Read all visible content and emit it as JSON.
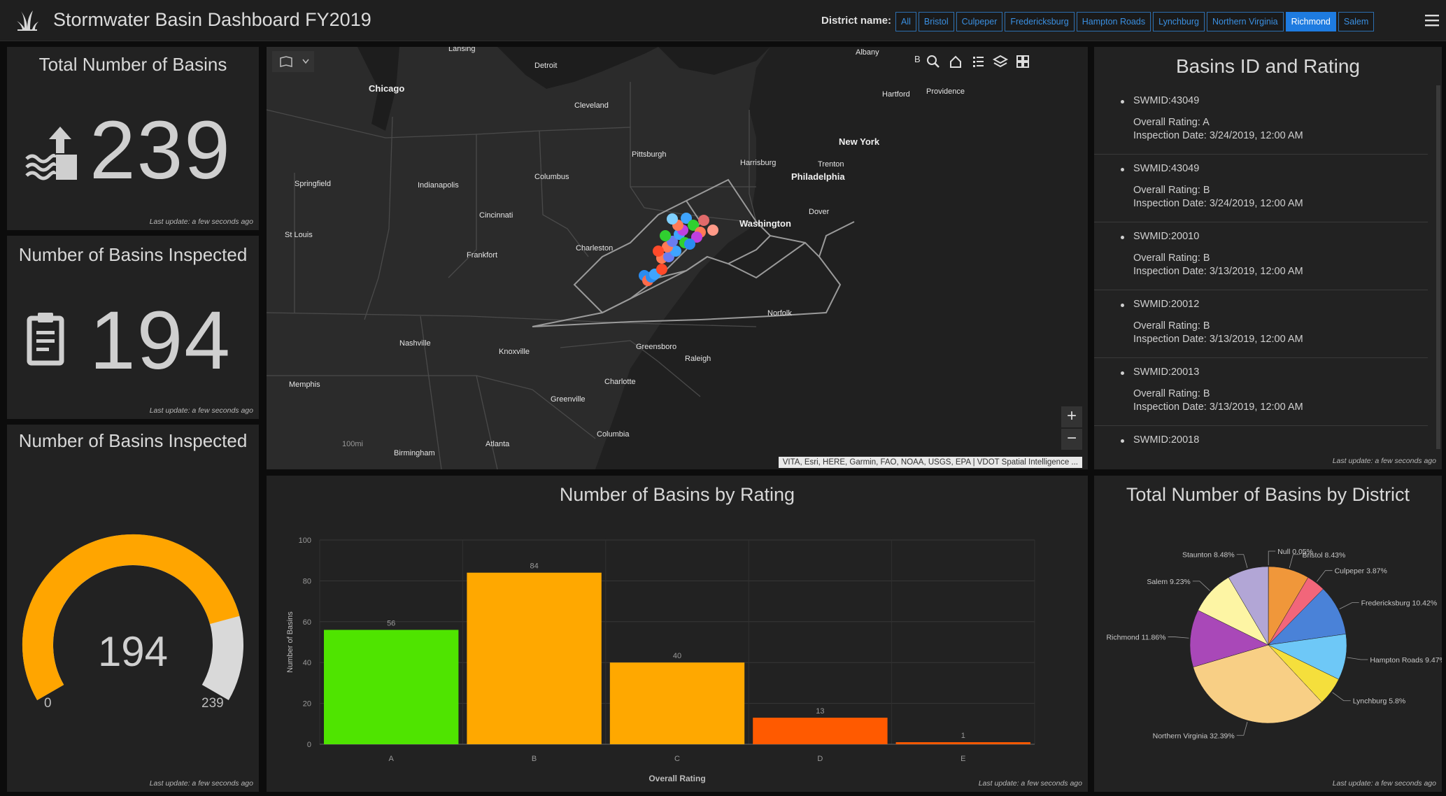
{
  "header": {
    "title": "Stormwater Basin Dashboard FY2019",
    "filter_label": "District name:",
    "districts": [
      "All",
      "Bristol",
      "Culpeper",
      "Fredericksburg",
      "Hampton Roads",
      "Lynchburg",
      "Northern Virginia",
      "Richmond",
      "Salem"
    ],
    "selected_district": "Richmond",
    "accent_color": "#1e7be0"
  },
  "indicator_total": {
    "title": "Total Number of Basins",
    "value": "239",
    "icon": "water-level-icon",
    "updated": "Last update: a few seconds ago"
  },
  "indicator_inspected": {
    "title": "Number of Basins Inspected",
    "value": "194",
    "icon": "clipboard-icon",
    "updated": "Last update: a few seconds ago"
  },
  "gauge": {
    "title": "Number of Basins Inspected",
    "value": 194,
    "value_label": "194",
    "min": 0,
    "max": 239,
    "min_label": "0",
    "max_label": "239",
    "fill_color": "#ffa500",
    "track_color": "#d9d9d9",
    "updated": "Last update: a few seconds ago"
  },
  "map": {
    "attribution": "VITA, Esri, HERE, Garmin, FAO, NOAA, USGS, EPA | VDOT Spatial Intelligence ...",
    "scale_label": "100mi",
    "partial_label": "B",
    "cities": {
      "lansing": "Lansing",
      "detroit": "Detroit",
      "albany": "Albany",
      "chicago": "Chicago",
      "cleveland": "Cleveland",
      "hartford": "Hartford",
      "providence": "Providence",
      "pittsburgh": "Pittsburgh",
      "new_york": "New York",
      "harrisburg": "Harrisburg",
      "trenton": "Trenton",
      "philadelphia": "Philadelphia",
      "springfield": "Springfield",
      "indianapolis": "Indianapolis",
      "columbus": "Columbus",
      "cincinnati": "Cincinnati",
      "washington": "Washington",
      "dover": "Dover",
      "st_louis": "St Louis",
      "frankfort": "Frankfort",
      "charleston": "Charleston",
      "nashville": "Nashville",
      "knoxville": "Knoxville",
      "greensboro": "Greensboro",
      "raleigh": "Raleigh",
      "norfolk": "Norfolk",
      "memphis": "Memphis",
      "charlotte": "Charlotte",
      "greenville": "Greenville",
      "columbia": "Columbia",
      "atlanta": "Atlanta",
      "birmingham": "Birmingham"
    }
  },
  "basin_list": {
    "title": "Basins ID and Rating",
    "items": [
      {
        "id": "SWMID:43049",
        "rating": "Overall Rating: A",
        "date": "Inspection Date: 3/24/2019, 12:00 AM"
      },
      {
        "id": "SWMID:43049",
        "rating": "Overall Rating: B",
        "date": "Inspection Date: 3/24/2019, 12:00 AM"
      },
      {
        "id": "SWMID:20010",
        "rating": "Overall Rating: B",
        "date": "Inspection Date: 3/13/2019, 12:00 AM"
      },
      {
        "id": "SWMID:20012",
        "rating": "Overall Rating: B",
        "date": "Inspection Date: 3/13/2019, 12:00 AM"
      },
      {
        "id": "SWMID:20013",
        "rating": "Overall Rating: B",
        "date": "Inspection Date: 3/13/2019, 12:00 AM"
      },
      {
        "id": "SWMID:20018",
        "rating": "",
        "date": ""
      }
    ],
    "updated": "Last update: a few seconds ago"
  },
  "bar_panel": {
    "title": "Number of Basins by Rating",
    "updated": "Last update: a few seconds ago"
  },
  "pie_panel": {
    "title": "Total Number of Basins by District",
    "updated": "Last update: a few seconds ago"
  },
  "chart_data": [
    {
      "type": "bar",
      "title": "Number of Basins by Rating",
      "xlabel": "Overall Rating",
      "ylabel": "Number of Basins",
      "categories": [
        "A",
        "B",
        "C",
        "D",
        "E"
      ],
      "values": [
        56,
        84,
        40,
        13,
        1
      ],
      "data_labels": [
        "56",
        "84",
        "40",
        "13",
        "1"
      ],
      "colors": [
        "#4fe400",
        "#ffa800",
        "#ffa800",
        "#ff5a00",
        "#ff5a00"
      ],
      "ylim": [
        0,
        100
      ],
      "yticks": [
        "0",
        "20",
        "40",
        "60",
        "80",
        "100"
      ],
      "grid": true
    },
    {
      "type": "pie",
      "title": "Total Number of Basins by District",
      "slices": [
        {
          "label": "Null 0.05%",
          "value": 0.05,
          "color": "#bfbfbf"
        },
        {
          "label": "Bristol 8.43%",
          "value": 8.43,
          "color": "#f0973a"
        },
        {
          "label": "Culpeper 3.87%",
          "value": 3.87,
          "color": "#f2667a"
        },
        {
          "label": "Fredericksburg 10.42%",
          "value": 10.42,
          "color": "#4a82d8"
        },
        {
          "label": "Hampton Roads 9.47%",
          "value": 9.47,
          "color": "#6ec8f7"
        },
        {
          "label": "Lynchburg 5.8%",
          "value": 5.8,
          "color": "#f5df3c"
        },
        {
          "label": "Northern Virginia 32.39%",
          "value": 32.39,
          "color": "#f8cf85"
        },
        {
          "label": "Richmond 11.86%",
          "value": 11.86,
          "color": "#a948b8"
        },
        {
          "label": "Salem 9.23%",
          "value": 9.23,
          "color": "#fdf5a4"
        },
        {
          "label": "Staunton 8.48%",
          "value": 8.48,
          "color": "#b2a6d6"
        }
      ]
    }
  ]
}
